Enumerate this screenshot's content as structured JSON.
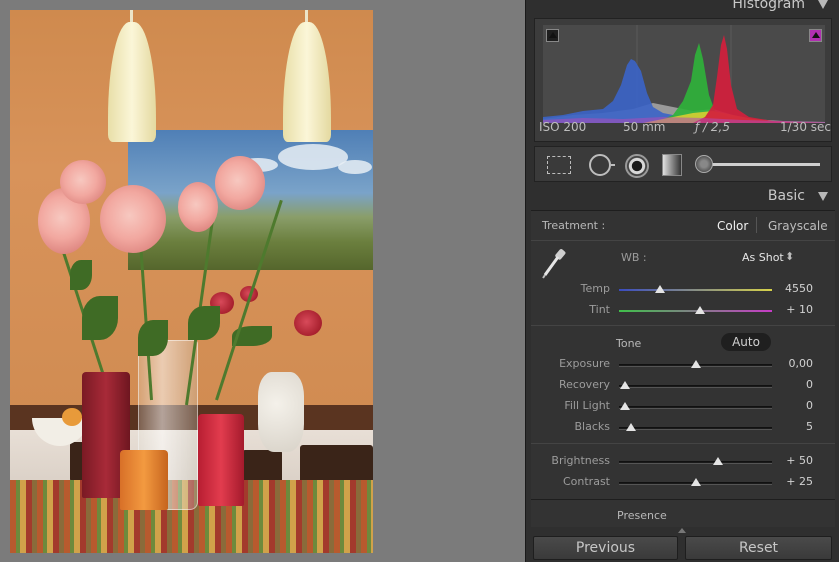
{
  "histogram_panel": {
    "title": "Histogram",
    "info": {
      "iso": "ISO 200",
      "focal": "50 mm",
      "aperture": "ƒ / 2,5",
      "shutter": "1/30 sec"
    },
    "colors": {
      "blue": "#3b64c8",
      "green": "#2fb43a",
      "red": "#d21e3c",
      "yellow": "#e0d030",
      "gray": "#9a9a9a"
    }
  },
  "tools": [
    "crop-overlay",
    "spot-removal",
    "red-eye-correction",
    "graduated-filter",
    "adjustment-brush"
  ],
  "basic": {
    "title": "Basic",
    "treatment_label": "Treatment :",
    "treatment_color": "Color",
    "treatment_gray": "Grayscale",
    "wb_label": "WB :",
    "wb_value": "As Shot",
    "wb_arrows": "⬍",
    "tone_label": "Tone",
    "auto_label": "Auto",
    "presence_label": "Presence",
    "sliders": [
      {
        "label": "Temp",
        "value": "4550",
        "position": 0.27
      },
      {
        "label": "Tint",
        "value": "+ 10",
        "position": 0.53
      },
      {
        "label": "Exposure",
        "value": "0,00",
        "position": 0.5
      },
      {
        "label": "Recovery",
        "value": "0",
        "position": 0.04
      },
      {
        "label": "Fill Light",
        "value": "0",
        "position": 0.04
      },
      {
        "label": "Blacks",
        "value": "5",
        "position": 0.08
      },
      {
        "label": "Brightness",
        "value": "+ 50",
        "position": 0.65
      },
      {
        "label": "Contrast",
        "value": "+ 25",
        "position": 0.5
      }
    ]
  },
  "buttons": {
    "previous": "Previous",
    "reset": "Reset"
  }
}
